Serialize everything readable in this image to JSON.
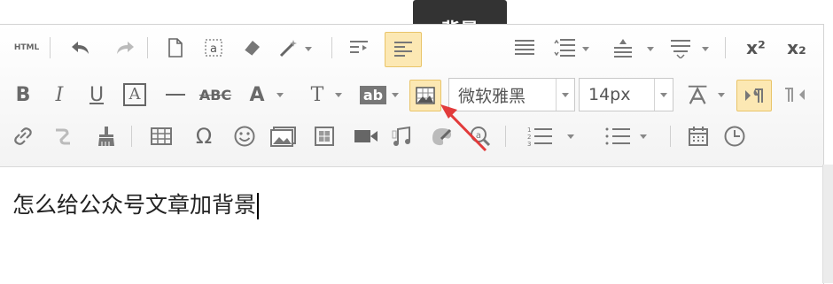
{
  "tooltip": {
    "text": "背景"
  },
  "toolbar": {
    "html_label": "HTML",
    "font_family_value": "微软雅黑",
    "font_size_value": "14px",
    "bold_label": "B",
    "italic_label": "I",
    "underline_label": "U",
    "font_border_label": "A",
    "strikethrough_label": "ABC",
    "font_color_label": "A",
    "text_indent_label": "T",
    "highlight_label": "ab",
    "omega_label": "Ω",
    "superscript_label": "x²",
    "subscript_label": "x₂"
  },
  "editor": {
    "content_text": "怎么给公众号文章加背景"
  },
  "colors": {
    "active_bg": "#fce8b3",
    "arrow_red": "#e23b3b",
    "tooltip_bg": "#333333"
  }
}
